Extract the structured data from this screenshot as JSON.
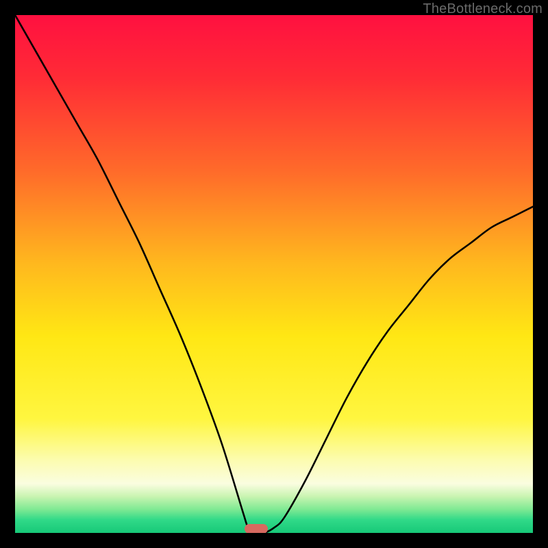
{
  "watermark": "TheBottleneck.com",
  "chart_data": {
    "type": "line",
    "title": "",
    "xlabel": "",
    "ylabel": "",
    "xlim": [
      0,
      100
    ],
    "ylim": [
      0,
      100
    ],
    "grid": false,
    "legend": false,
    "gradient_stops": [
      {
        "offset": 0.0,
        "color": "#ff1040"
      },
      {
        "offset": 0.12,
        "color": "#ff2b36"
      },
      {
        "offset": 0.3,
        "color": "#ff6a2a"
      },
      {
        "offset": 0.48,
        "color": "#ffb81e"
      },
      {
        "offset": 0.62,
        "color": "#ffe714"
      },
      {
        "offset": 0.78,
        "color": "#fff640"
      },
      {
        "offset": 0.86,
        "color": "#fcfcb0"
      },
      {
        "offset": 0.905,
        "color": "#fafde0"
      },
      {
        "offset": 0.93,
        "color": "#c8f4b0"
      },
      {
        "offset": 0.955,
        "color": "#7de993"
      },
      {
        "offset": 0.975,
        "color": "#30d988"
      },
      {
        "offset": 1.0,
        "color": "#17c978"
      }
    ],
    "series": [
      {
        "name": "bottleneck-curve",
        "x": [
          0,
          4,
          8,
          12,
          16,
          20,
          24,
          28,
          32,
          36,
          40,
          44,
          45,
          46,
          48,
          50,
          52,
          56,
          60,
          64,
          68,
          72,
          76,
          80,
          84,
          88,
          92,
          96,
          100
        ],
        "y": [
          100,
          93,
          86,
          79,
          72,
          64,
          56,
          47,
          38,
          28,
          17,
          4,
          1,
          0,
          0,
          1,
          3,
          10,
          18,
          26,
          33,
          39,
          44,
          49,
          53,
          56,
          59,
          61,
          63
        ]
      }
    ],
    "marker": {
      "x": 46.5,
      "y": 0.8,
      "color": "#d76a60"
    }
  }
}
